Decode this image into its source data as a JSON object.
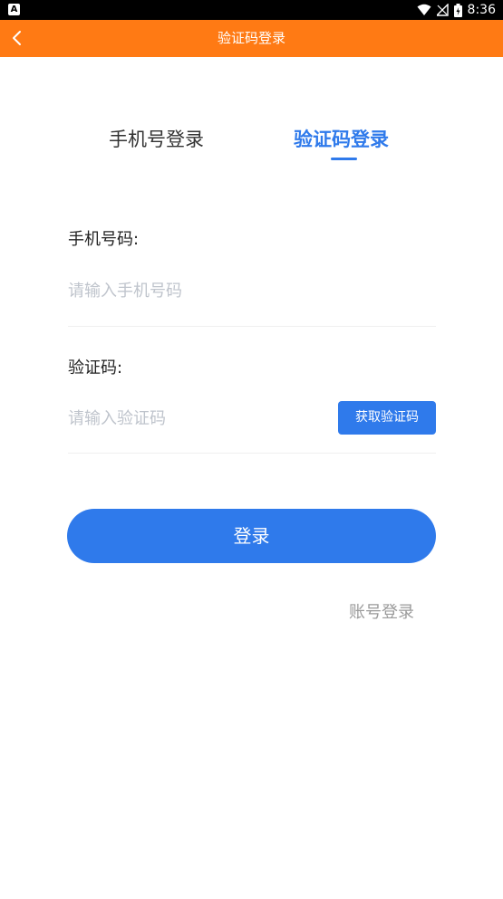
{
  "status_bar": {
    "left_icon": "A",
    "time": "8:36",
    "icons": [
      "wifi-icon",
      "signal-off-icon",
      "battery-charging-icon"
    ]
  },
  "app_bar": {
    "title": "验证码登录",
    "back_icon": "chevron-left-icon",
    "background": "#FF7A14"
  },
  "tabs": {
    "phone_login": "手机号登录",
    "code_login": "验证码登录",
    "active": "code_login",
    "active_color": "#2F7AEB"
  },
  "form": {
    "phone_label": "手机号码:",
    "phone_placeholder": "请输入手机号码",
    "phone_value": "",
    "code_label": "验证码:",
    "code_placeholder": "请输入验证码",
    "code_value": "",
    "get_code_button": "获取验证码"
  },
  "actions": {
    "login_button": "登录",
    "account_login_link": "账号登录"
  }
}
